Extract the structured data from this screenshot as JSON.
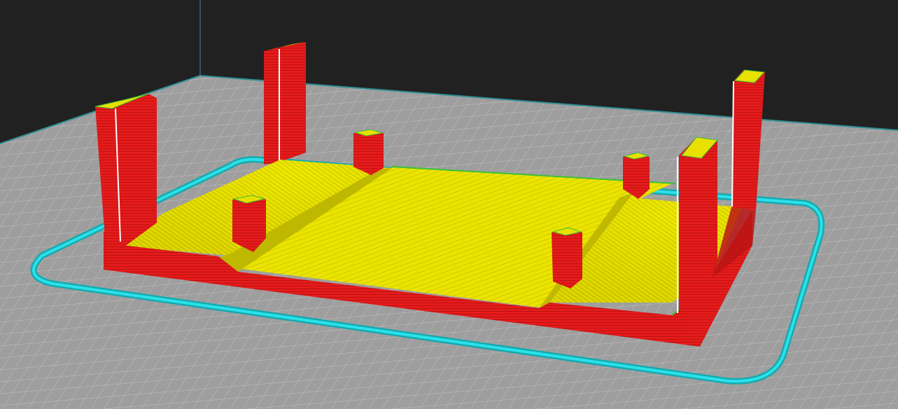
{
  "viewport": {
    "kind": "3D layer preview",
    "colors": {
      "background": "#212121",
      "bed_base": "#9d9d9d",
      "bed_grid": "#c6c6c6",
      "bed_edge": "#2a7f88",
      "skirt": "#25d6dd",
      "skirt_dark": "#13a8b0",
      "perimeter_red": "#e81c1c",
      "perimeter_red_dark": "#b71212",
      "infill_yellow": "#e9e200",
      "infill_yellow_dark": "#c7c000",
      "seam_white": "#ffffff",
      "edge_green": "#35c23c"
    }
  }
}
